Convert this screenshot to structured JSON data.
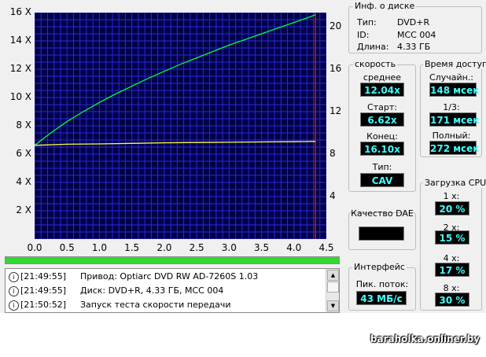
{
  "chart_data": {
    "type": "line",
    "x_ticks": [
      "0.0",
      "0.5",
      "1.0",
      "1.5",
      "2.0",
      "2.5",
      "3.0",
      "3.5",
      "4.0",
      "4.5"
    ],
    "xlim": [
      0,
      4.5
    ],
    "y_left_ticks": [
      "2 X",
      "4 X",
      "6 X",
      "8 X",
      "10 X",
      "12 X",
      "14 X",
      "16 X"
    ],
    "y_left_lim": [
      0,
      16
    ],
    "y_right_ticks": [
      "4",
      "8",
      "12",
      "16",
      "20"
    ],
    "y_right_lim": [
      0,
      21.3
    ],
    "end_marker_x": 4.33,
    "series": [
      {
        "color": "#00ff40",
        "x": [
          0,
          0.25,
          0.5,
          0.75,
          1.0,
          1.25,
          1.5,
          1.75,
          2.0,
          2.25,
          2.5,
          2.75,
          3.0,
          3.25,
          3.5,
          3.75,
          4.0,
          4.25,
          4.33
        ],
        "y": [
          6.62,
          7.5,
          8.3,
          9.0,
          9.65,
          10.25,
          10.8,
          11.35,
          11.85,
          12.35,
          12.8,
          13.25,
          13.7,
          14.1,
          14.5,
          14.9,
          15.3,
          15.7,
          15.85
        ]
      },
      {
        "color": "#ffff40",
        "x": [
          0,
          0.5,
          1.0,
          1.5,
          2.0,
          2.5,
          3.0,
          3.5,
          4.0,
          4.33
        ],
        "y": [
          6.62,
          6.7,
          6.72,
          6.76,
          6.8,
          6.82,
          6.84,
          6.86,
          6.88,
          6.9
        ]
      }
    ],
    "grid": true,
    "colors": {
      "background": "#00004a",
      "grid": "#2b2bd0",
      "marker": "#c02020"
    }
  },
  "log": {
    "entries": [
      {
        "time": "[21:49:55]",
        "message": "Привод: Optiarc DVD RW AD-7260S  1.03"
      },
      {
        "time": "[21:49:55]",
        "message": "Диск: DVD+R, 4.33 ГБ, MCC 004"
      },
      {
        "time": "[21:50:52]",
        "message": "Запуск теста скорости передачи"
      }
    ]
  },
  "disc": {
    "title": "Инф. о диске",
    "type_label": "Тип:",
    "type_value": "DVD+R",
    "id_label": "ID:",
    "id_value": "MCC 004",
    "length_label": "Длина:",
    "length_value": "4.33 ГБ"
  },
  "speed": {
    "title": "скорость",
    "avg_label": "среднее",
    "avg_value": "12.04x",
    "start_label": "Старт:",
    "start_value": "6.62x",
    "end_label": "Конец:",
    "end_value": "16.10x",
    "type_label": "Тип:",
    "type_value": "CAV"
  },
  "access": {
    "title": "Время доступа",
    "random_label": "Случайн.:",
    "random_value": "148 мсек",
    "third_label": "1/3:",
    "third_value": "171 мсек",
    "full_label": "Полный:",
    "full_value": "272 мсек"
  },
  "dae": {
    "title": "Качество DAE"
  },
  "interface": {
    "title": "Интерфейс",
    "burst_label": "Пик. поток:",
    "burst_value": "43 МБ/с"
  },
  "cpu": {
    "title": "Загрузка CPU",
    "items": [
      {
        "label": "1 x:",
        "value": "20 %"
      },
      {
        "label": "2 x:",
        "value": "15 %"
      },
      {
        "label": "4 x:",
        "value": "17 %"
      },
      {
        "label": "8 x:",
        "value": "30 %"
      }
    ]
  },
  "progress_value": 1.0,
  "watermark": "baraholka.onliner.by"
}
